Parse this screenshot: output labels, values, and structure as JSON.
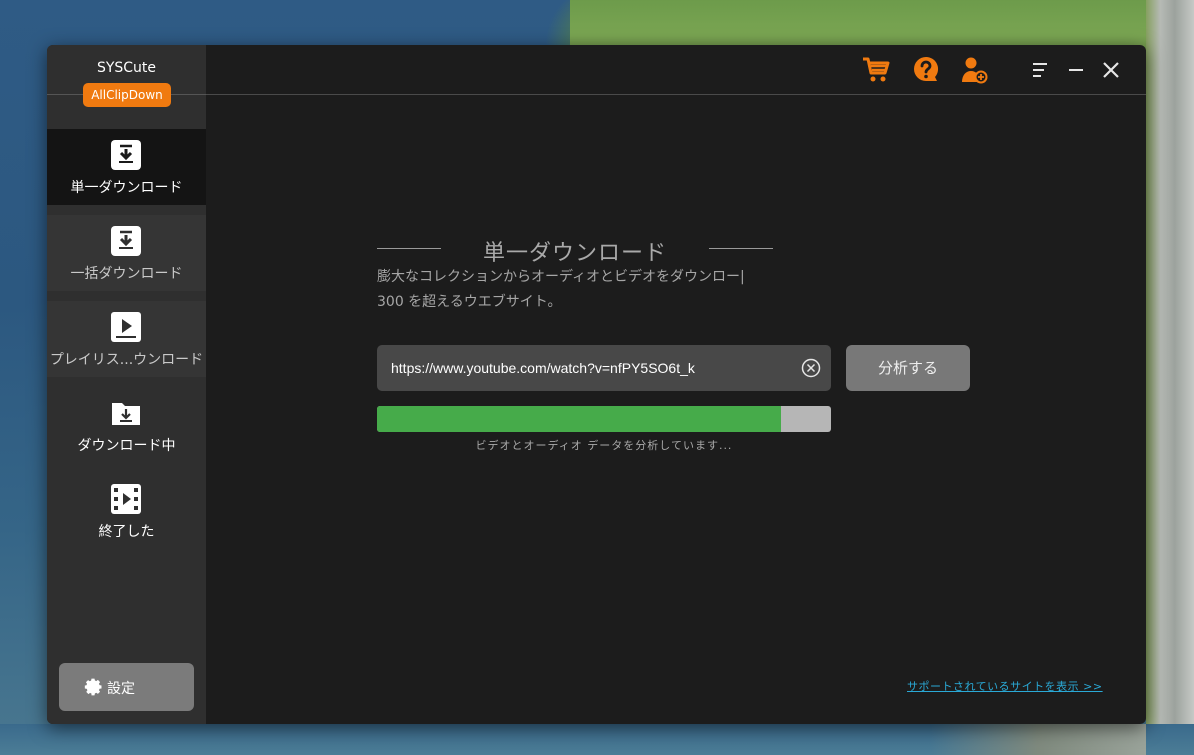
{
  "app": {
    "name": "SYSCute",
    "badge": "AllClipDown"
  },
  "sidebar": {
    "items": [
      {
        "label": "単一ダウンロード",
        "icon": "download-box-icon",
        "active": true
      },
      {
        "label": "一括ダウンロード",
        "icon": "download-box-icon",
        "active": false
      },
      {
        "label": "プレイリス...ウンロード",
        "icon": "play-box-icon",
        "active": false
      },
      {
        "label": "ダウンロード中",
        "icon": "download-folder-icon",
        "active": false
      },
      {
        "label": "終了した",
        "icon": "film-icon",
        "active": false
      }
    ],
    "settings_label": "設定"
  },
  "main": {
    "title": "単一ダウンロード",
    "subtitle_line1": "膨大なコレクションからオーディオとビデオをダウンロー|",
    "subtitle_line2": "300 を超えるウエブサイト。",
    "url_value": "https://www.youtube.com/watch?v=nfPY5SO6t_k",
    "analyze_label": "分析する",
    "progress_percent": 89,
    "status_text": "ビデオとオーディオ データを分析しています...",
    "support_link": "サポートされているサイトを表示 >>"
  },
  "colors": {
    "accent": "#f07a10",
    "progress": "#46ab4a",
    "link": "#2aa9d6"
  }
}
